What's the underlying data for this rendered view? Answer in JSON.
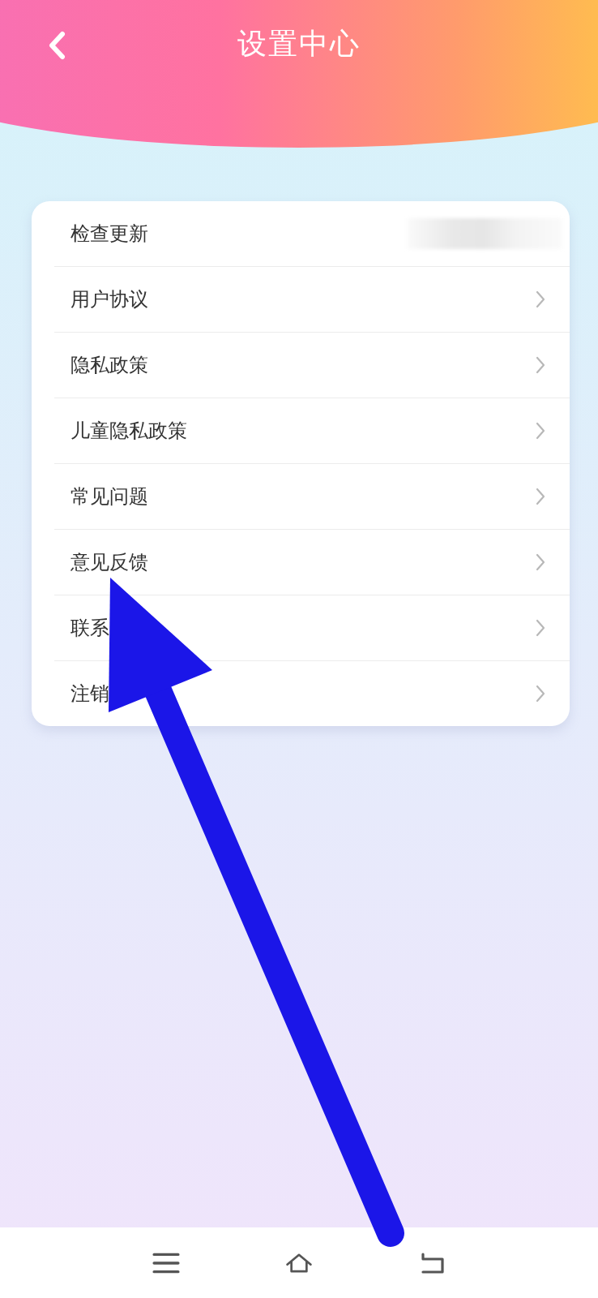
{
  "header": {
    "title": "设置中心"
  },
  "settings": [
    {
      "label": "检查更新",
      "kind": "blurred"
    },
    {
      "label": "用户协议",
      "kind": "link"
    },
    {
      "label": "隐私政策",
      "kind": "link"
    },
    {
      "label": "儿童隐私政策",
      "kind": "link"
    },
    {
      "label": "常见问题",
      "kind": "link"
    },
    {
      "label": "意见反馈",
      "kind": "link"
    },
    {
      "label": "联系",
      "kind": "link"
    },
    {
      "label": "注销",
      "kind": "link"
    }
  ]
}
